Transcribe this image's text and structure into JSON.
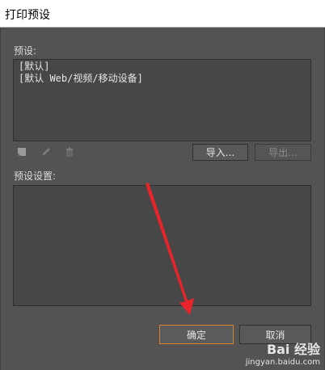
{
  "window": {
    "title": "打印预设"
  },
  "presets": {
    "label": "预设:",
    "items": [
      "[默认]",
      "[默认 Web/视频/移动设备]"
    ]
  },
  "toolbar": {
    "icons": [
      "new-preset-icon",
      "edit-pencil-icon",
      "delete-trash-icon"
    ],
    "import_label": "导入...",
    "export_label": "导出..."
  },
  "preset_settings": {
    "label": "预设设置:"
  },
  "footer": {
    "ok_label": "确定",
    "cancel_label": "取消"
  },
  "watermark": {
    "logo": "Bai 经验",
    "url": "jingyan.baidu.com"
  },
  "colors": {
    "dialog_bg": "#535353",
    "field_bg": "#474747",
    "focus_border": "#d8832a",
    "annotation_arrow": "#e8242a"
  }
}
